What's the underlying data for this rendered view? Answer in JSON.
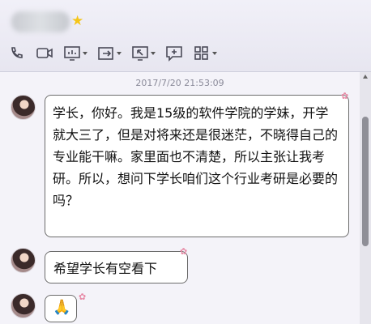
{
  "header": {
    "contact_name": "",
    "star_icon": "star",
    "toolbar": [
      {
        "name": "phone-icon",
        "has_menu": false
      },
      {
        "name": "video-icon",
        "has_menu": false
      },
      {
        "name": "screen-share-icon",
        "has_menu": true
      },
      {
        "name": "file-transfer-icon",
        "has_menu": true
      },
      {
        "name": "remote-desktop-icon",
        "has_menu": true
      },
      {
        "name": "message-icon",
        "has_menu": false
      },
      {
        "name": "apps-grid-icon",
        "has_menu": true
      }
    ]
  },
  "chat": {
    "timestamp": "2017/7/20 21:53:09",
    "messages": [
      {
        "text": "学长，你好。我是15级的软件学院的学妹，开学就大三了，但是对将来还是很迷茫，不晓得自己的专业能干嘛。家里面也不清楚，所以主张让我考研。所以，想问下学长咱们这个行业考研是必要的吗？"
      },
      {
        "text": "希望学长有空看下"
      },
      {
        "text": "🙏"
      }
    ]
  },
  "colors": {
    "accent_star": "#f5c518",
    "bubble_border": "#6c6c6c",
    "background": "#f4f3f9"
  }
}
